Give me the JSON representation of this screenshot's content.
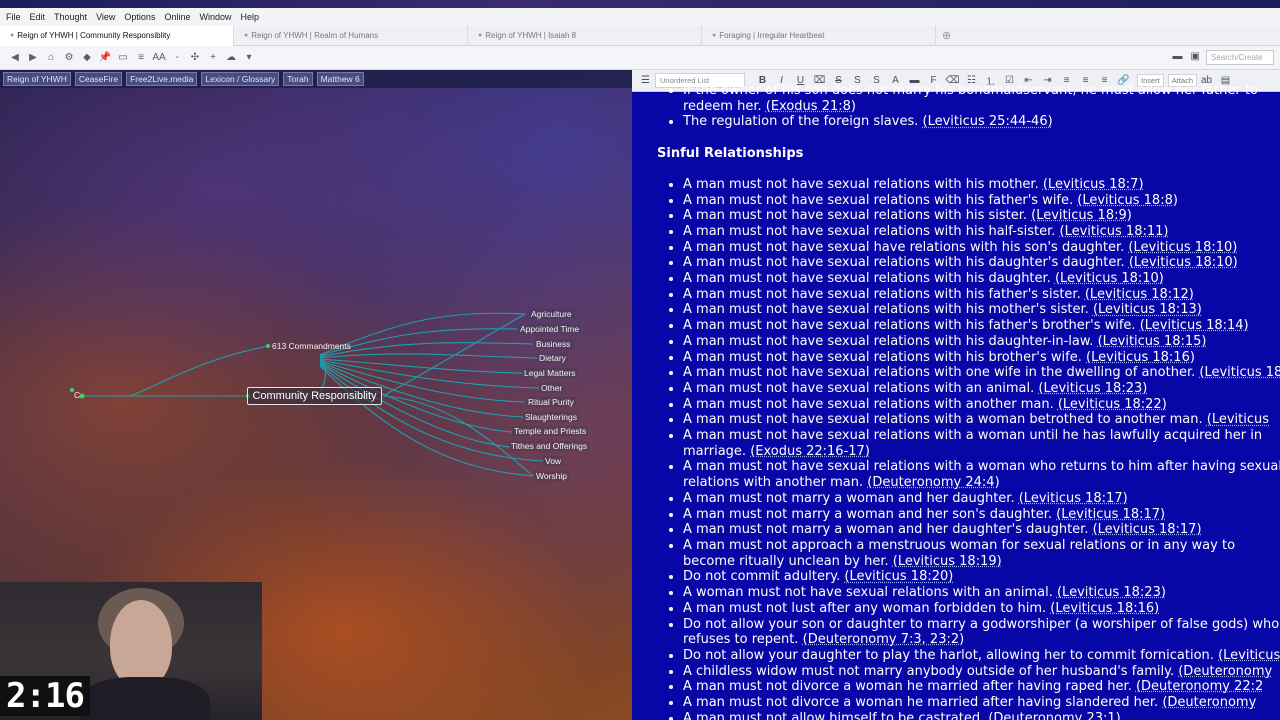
{
  "menu": [
    "File",
    "Edit",
    "Thought",
    "View",
    "Options",
    "Online",
    "Window",
    "Help"
  ],
  "tabs": [
    {
      "label": "Reign of YHWH | Community Responsiblity",
      "active": true
    },
    {
      "label": "Reign of YHWH | Realm of Humans",
      "active": false
    },
    {
      "label": "Reign of YHWH | Isaiah 8",
      "active": false
    },
    {
      "label": "Foraging | Irregular Heartbeat",
      "active": false
    }
  ],
  "toolbar": {
    "search_placeholder": "Search/Create",
    "font_icon": "AA"
  },
  "pins": [
    "Reign of YHWH",
    "CeaseFire",
    "Free2Live.media",
    "Lexicon / Glossary",
    "Torah",
    "Matthew 6"
  ],
  "plex": {
    "active_thought": "Community Responsiblity",
    "parent": "613 Commandments",
    "left_node": "C",
    "children": [
      "Agriculture",
      "Appointed Time",
      "Business",
      "Dietary",
      "Legal Matters",
      "Other",
      "Ritual Purity",
      "Slaughterings",
      "Temple and Priests",
      "Tithes and Offerings",
      "Vow",
      "Worship"
    ]
  },
  "timer": "2:16",
  "editor": {
    "list_style": "Unordered List",
    "insert_label": "Insert",
    "attach_label": "Attach",
    "pre_items": [
      {
        "text": "If the owner of his son does not marry his bondmaidservant, he must allow her father to redeem her. ",
        "ref": "(Exodus 21:8)"
      },
      {
        "text": "The regulation of the foreign slaves. ",
        "ref": "(Leviticus 25:44-46)"
      }
    ],
    "heading": "Sinful Relationships",
    "items": [
      {
        "text": "A man must not have sexual relations with his mother. ",
        "ref": "(Leviticus 18:7)"
      },
      {
        "text": "A man must not have sexual relations with his father's wife. ",
        "ref": "(Leviticus 18:8)"
      },
      {
        "text": "A man must not have sexual relations with his sister. ",
        "ref": "(Leviticus 18:9)"
      },
      {
        "text": "A man must not have sexual relations with his half-sister. ",
        "ref": "(Leviticus 18:11)"
      },
      {
        "text": "A man must not have sexual have relations with his son's daughter. ",
        "ref": "(Leviticus 18:10)"
      },
      {
        "text": "A man must not have sexual relations with his daughter's daughter. ",
        "ref": "(Leviticus 18:10)"
      },
      {
        "text": "A man must not have sexual relations with his daughter. ",
        "ref": "(Leviticus 18:10)"
      },
      {
        "text": "A man must not have sexual relations with his father's sister. ",
        "ref": "(Leviticus 18:12)"
      },
      {
        "text": "A man must not have sexual relations with his mother's sister. ",
        "ref": "(Leviticus 18:13)"
      },
      {
        "text": "A man must not have sexual relations with his father's brother's wife. ",
        "ref": "(Leviticus 18:14)"
      },
      {
        "text": "A man must not have sexual relations with his daughter-in-law. ",
        "ref": "(Leviticus 18:15)"
      },
      {
        "text": "A man must not have sexual relations with his brother's wife. ",
        "ref": "(Leviticus 18:16)"
      },
      {
        "text": "A man must not have sexual relations with one wife in the dwelling of another. ",
        "ref": "(Leviticus 18"
      },
      {
        "text": "A man must not have sexual relations with an animal. ",
        "ref": "(Leviticus 18:23)"
      },
      {
        "text": "A man must not have sexual relations with another man. ",
        "ref": "(Leviticus 18:22)"
      },
      {
        "text": "A man must not have sexual relations with a woman betrothed to another man. ",
        "ref": "(Leviticus"
      },
      {
        "text": "A man must not have sexual relations with a woman until he has lawfully acquired her in marriage. ",
        "ref": "(Exodus 22:16-17)",
        "wrap": true
      },
      {
        "text": "A man must not have sexual relations with a woman who returns to him after having sexual relations with another man. ",
        "ref": "(Deuteronomy 24:4)",
        "wrap": true
      },
      {
        "text": "A man must not marry a woman and her daughter. ",
        "ref": "(Leviticus 18:17)"
      },
      {
        "text": "A man must not marry a woman and her son's daughter. ",
        "ref": "(Leviticus 18:17)"
      },
      {
        "text": "A man must not marry a woman and her daughter's daughter. ",
        "ref": "(Leviticus 18:17)"
      },
      {
        "text": "A man must not approach a menstruous woman for sexual relations or in any way to become ritually unclean by her. ",
        "ref": "(Leviticus 18:19)",
        "wrap": true
      },
      {
        "text": "Do not commit adultery. ",
        "ref": "(Leviticus 18:20)"
      },
      {
        "text": "A woman must not have sexual relations with an animal. ",
        "ref": "(Leviticus 18:23)"
      },
      {
        "text": "A man must not lust after any woman forbidden to him. ",
        "ref": "(Leviticus 18:16)"
      },
      {
        "text": "Do not allow your son or daughter to marry a godworshiper (a worshiper of false gods) who refuses to repent. ",
        "ref": "(Deuteronomy 7:3, 23:2)",
        "wrap": true
      },
      {
        "text": "Do not allow your daughter to play the harlot, allowing her to commit fornication. ",
        "ref": "(Leviticus"
      },
      {
        "text": "A childless widow must not marry anybody outside of her husband's family. ",
        "ref": "(Deuteronomy"
      },
      {
        "text": "A man must not divorce a woman he married after having raped her. ",
        "ref": "(Deuteronomy 22:2"
      },
      {
        "text": "A man must not divorce a woman he married after having slandered her. ",
        "ref": "(Deuteronomy"
      },
      {
        "text": "A man must not allow himself to be castrated. ",
        "ref": "(Deuteronomy 23:1)"
      }
    ]
  }
}
